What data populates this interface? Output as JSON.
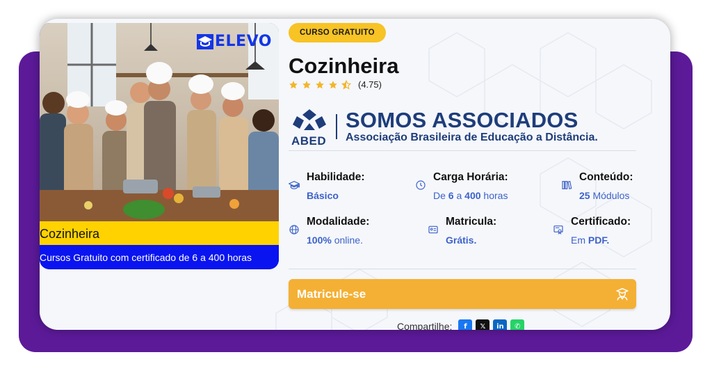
{
  "image": {
    "brand": "ELEVO",
    "title": "Cozinheira",
    "subtitle": "Cursos Gratuito com certificado de 6 a 400 horas"
  },
  "badge": "CURSO GRATUITO",
  "course_title": "Cozinheira",
  "rating": {
    "value": "(4.75)",
    "stars": 4.75,
    "star_color": "#f4b52c"
  },
  "association": {
    "acronym": "ABED",
    "title": "SOMOS ASSOCIADOS",
    "subtitle": "Associação Brasileira de Educação a Distância."
  },
  "info": {
    "habilidade": {
      "label": "Habilidade:",
      "value": "Básico",
      "icon": "graduation-cap-icon"
    },
    "carga": {
      "label": "Carga Horária:",
      "prefix": "De ",
      "min": "6",
      "mid": " a ",
      "max": "400",
      "suffix": " horas",
      "icon": "clock-icon"
    },
    "conteudo": {
      "label": "Conteúdo:",
      "count": "25",
      "suffix": " Módulos",
      "icon": "books-icon"
    },
    "modalidade": {
      "label": "Modalidade:",
      "strong": "100%",
      "suffix": " online.",
      "icon": "globe-icon"
    },
    "matricula": {
      "label": "Matricula:",
      "value": "Grátis.",
      "icon": "id-card-icon"
    },
    "certificado": {
      "label": "Certificado:",
      "prefix": "Em ",
      "strong": "PDF.",
      "icon": "certificate-icon"
    }
  },
  "cta": {
    "label": "Matricule-se",
    "icon": "student-icon"
  },
  "share": {
    "label": "Compartilhe:",
    "buttons": [
      {
        "name": "facebook",
        "glyph": "f",
        "color": "#1877f2"
      },
      {
        "name": "x",
        "glyph": "𝕏",
        "color": "#111111"
      },
      {
        "name": "linkedin",
        "glyph": "in",
        "color": "#0a66c2"
      },
      {
        "name": "whatsapp",
        "glyph": "✆",
        "color": "#25d366"
      }
    ]
  },
  "colors": {
    "purple": "#5c1a99",
    "badge": "#f7c325",
    "cta": "#f4b034",
    "accent_blue": "#3d62c8",
    "abed_blue": "#1e3d7a"
  }
}
